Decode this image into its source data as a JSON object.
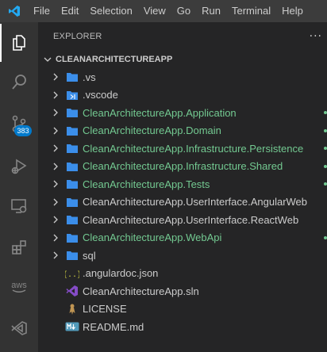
{
  "menu": [
    "File",
    "Edit",
    "Selection",
    "View",
    "Go",
    "Run",
    "Terminal",
    "Help"
  ],
  "activity": {
    "source_control_badge": "383",
    "items": [
      "explorer-icon",
      "search-icon",
      "source-control-icon",
      "run-debug-icon",
      "remote-explorer-icon",
      "extensions-icon",
      "aws-icon",
      "visual-studio-icon"
    ]
  },
  "explorer": {
    "title": "EXPLORER",
    "more": "···",
    "root": "CLEANARCHITECTUREAPP",
    "items": [
      {
        "label": ".vs",
        "type": "folder"
      },
      {
        "label": ".vscode",
        "type": "folder-vscode"
      },
      {
        "label": "CleanArchitectureApp.Application",
        "type": "folder"
      },
      {
        "label": "CleanArchitectureApp.Domain",
        "type": "folder"
      },
      {
        "label": "CleanArchitectureApp.Infrastructure.Persistence",
        "type": "folder"
      },
      {
        "label": "CleanArchitectureApp.Infrastructure.Shared",
        "type": "folder"
      },
      {
        "label": "CleanArchitectureApp.Tests",
        "type": "folder"
      },
      {
        "label": "CleanArchitectureApp.UserInterface.AngularWeb",
        "type": "folder"
      },
      {
        "label": "CleanArchitectureApp.UserInterface.ReactWeb",
        "type": "folder"
      },
      {
        "label": "CleanArchitectureApp.WebApi",
        "type": "folder"
      },
      {
        "label": "sql",
        "type": "folder"
      },
      {
        "label": ".angulardoc.json",
        "type": "json-file"
      },
      {
        "label": "CleanArchitectureApp.sln",
        "type": "sln-file"
      },
      {
        "label": "LICENSE",
        "type": "license-file"
      },
      {
        "label": "README.md",
        "type": "markdown-file"
      }
    ]
  },
  "colors": {
    "git_added": "#73c991",
    "folder": "#3b8eea",
    "accent": "#007acc"
  }
}
